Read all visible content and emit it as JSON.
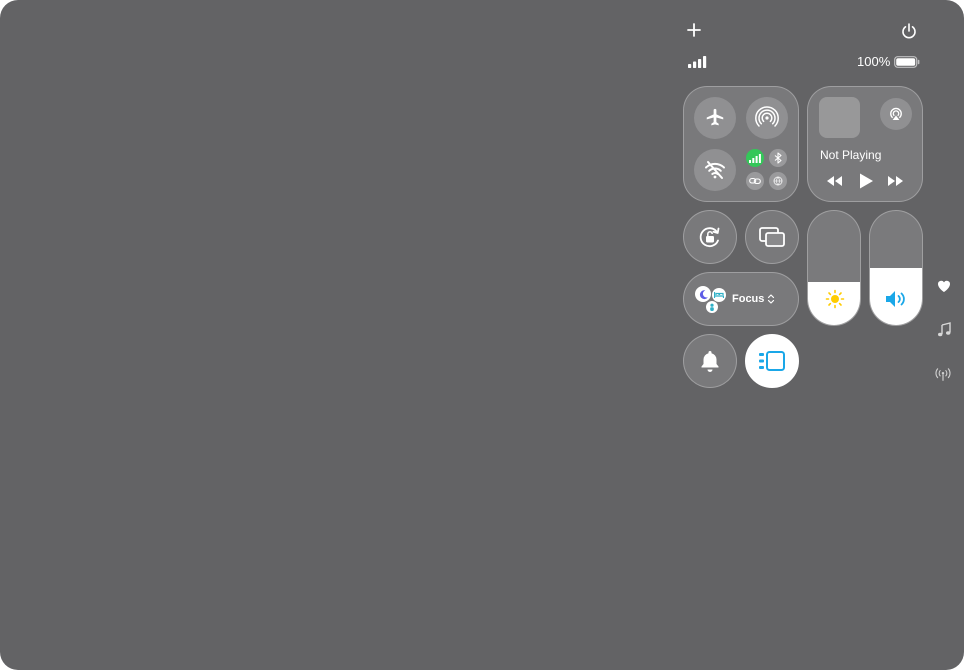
{
  "status": {
    "battery_percent": "100%",
    "cellular_bars": 4,
    "battery_level": 1.0
  },
  "connectivity": {
    "airplane_mode": "off",
    "airdrop": "off",
    "wifi": "off",
    "cellular": "on",
    "bluetooth": "off",
    "hotspot": "off",
    "vpn": "off"
  },
  "media": {
    "status_text": "Not Playing"
  },
  "focus": {
    "label": "Focus"
  },
  "sliders": {
    "brightness_level": 0.38,
    "volume_level": 0.5
  },
  "colors": {
    "background": "#636365",
    "cellular_active": "#34c759",
    "brightness_icon": "#ffcc00",
    "volume_icon": "#1aa7e8",
    "focus_moon": "#5e5ce6",
    "focus_sleep": "#30b0c7",
    "stage_manager_icon": "#1aa7e8"
  },
  "icons": {
    "top_left": "plus-icon",
    "top_right": "power-icon",
    "side_rail": [
      "heart-icon",
      "music-note-icon",
      "antenna-icon"
    ]
  }
}
